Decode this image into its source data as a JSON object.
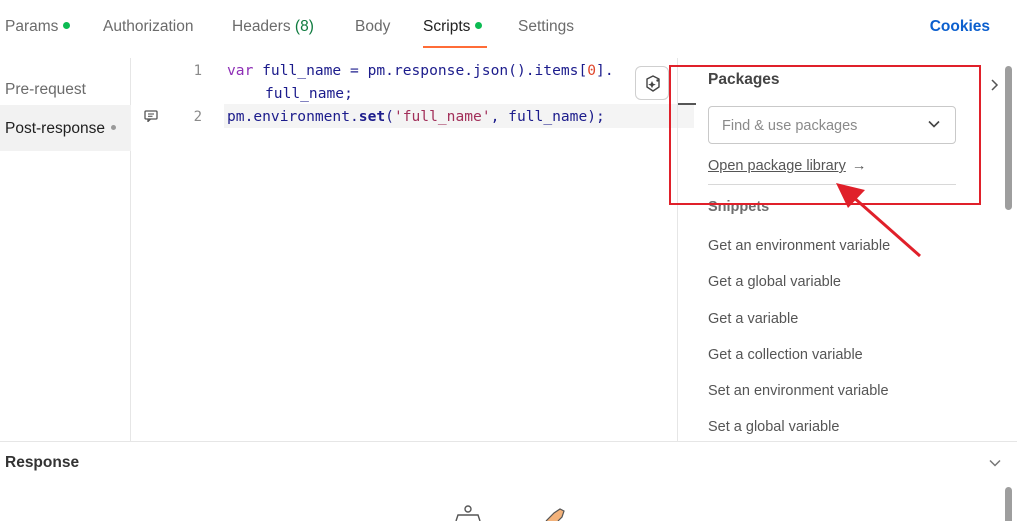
{
  "tabs": [
    {
      "label": "Params",
      "dot": true
    },
    {
      "label": "Authorization"
    },
    {
      "label": "Headers",
      "count": "(8)"
    },
    {
      "label": "Body"
    },
    {
      "label": "Scripts",
      "dot": true,
      "active": true
    },
    {
      "label": "Settings"
    }
  ],
  "cookies_label": "Cookies",
  "left_nav": {
    "items": [
      {
        "label": "Pre-request"
      },
      {
        "label": "Post-response",
        "active": true
      }
    ]
  },
  "editor": {
    "line_numbers": [
      "1",
      "2"
    ],
    "line1": {
      "kw": "var",
      "rest_a": " full_name = pm.response.json().items[",
      "num": "0",
      "rest_b": "].",
      "wrap": "full_name;"
    },
    "line2": {
      "obj": "pm.environment.",
      "fn": "set",
      "open": "(",
      "str": "'full_name'",
      "rest": ", full_name);"
    }
  },
  "packages": {
    "title": "Packages",
    "search_placeholder": "Find & use packages",
    "open_library_label": "Open package library",
    "open_library_arrow": "→"
  },
  "snippets": {
    "title": "Snippets",
    "items": [
      "Get an environment variable",
      "Get a global variable",
      "Get a variable",
      "Get a collection variable",
      "Set an environment variable",
      "Set a global variable"
    ]
  },
  "response": {
    "title": "Response"
  },
  "colors": {
    "accent": "#ff6c37",
    "status_dot": "#0cbb52",
    "link": "#0b5fce",
    "annotation": "#e0202a"
  },
  "icons": {
    "ai_assist": "ai-sparkle-icon",
    "comment": "comment-icon",
    "chevron": "chevron-down-icon",
    "collapse": "chevron-right-icon"
  }
}
